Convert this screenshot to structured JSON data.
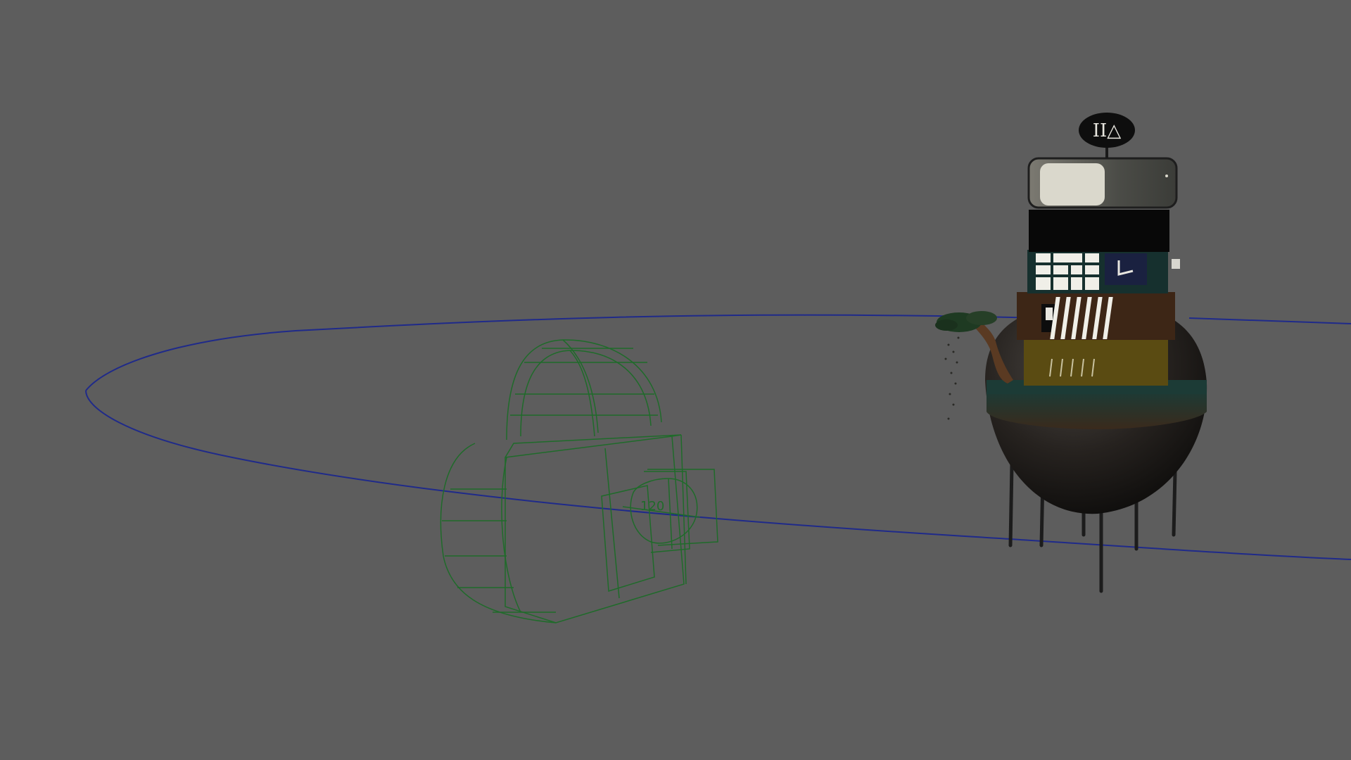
{
  "viewport": {
    "background": "#5d5d5d",
    "wireframe_color": "#1f6b2a",
    "path_color": "#1f2a8a"
  },
  "camera": {
    "icon": "camera-wireframe-icon",
    "label": "120"
  },
  "building": {
    "sign_text": "II△"
  }
}
